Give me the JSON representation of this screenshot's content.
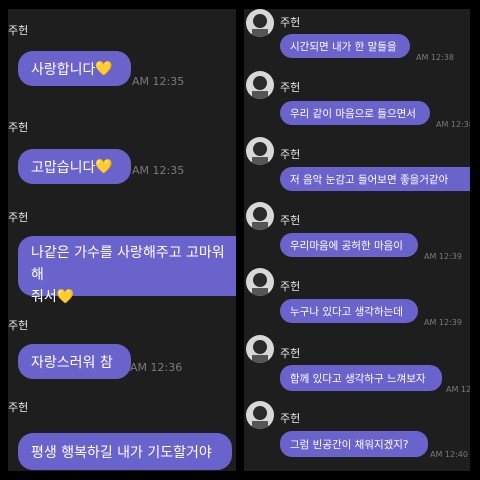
{
  "left_panel": {
    "messages": [
      {
        "sender": "주헌",
        "text": "사랑합니다",
        "heart": "💛",
        "time": "AM 12:35"
      },
      {
        "sender": "주헌",
        "text": "고맙습니다",
        "heart": "💛",
        "time": "AM 12:35"
      },
      {
        "sender": "주헌",
        "line1": "나같은 가수를 사랑해주고 고마워해",
        "line2": "줘서",
        "heart": "💛"
      },
      {
        "sender": "주헌",
        "text": "자랑스러워 참",
        "time": "AM 12:36"
      },
      {
        "sender": "주헌",
        "text": "평생 행복하길 내가 기도할거야"
      }
    ]
  },
  "right_panel": {
    "messages": [
      {
        "sender": "주헌",
        "text": "시간되면 내가 한 말들을",
        "time": "AM 12:38"
      },
      {
        "sender": "주헌",
        "text": "우리 같이 마음으로 들으면서",
        "time": "AM 12:38"
      },
      {
        "sender": "주헌",
        "text": "저 음악 눈감고 들어보면 좋을거같아",
        "time": ""
      },
      {
        "sender": "주헌",
        "text": "우리마음에 공허한 마음이",
        "time": "AM 12:39"
      },
      {
        "sender": "주헌",
        "text": "누구나 있다고 생각하는데",
        "time": "AM 12:39"
      },
      {
        "sender": "주헌",
        "text": "함께 있다고 생각하구 느껴보자",
        "time": "AM 12:39"
      },
      {
        "sender": "주헌",
        "text": "그럼 빈공간이 채워지겠지?",
        "time": "AM 12:40"
      }
    ]
  },
  "colors": {
    "bubble": "#6b63cc",
    "background": "#1e1e1e",
    "timestamp": "#7a7a7a"
  }
}
